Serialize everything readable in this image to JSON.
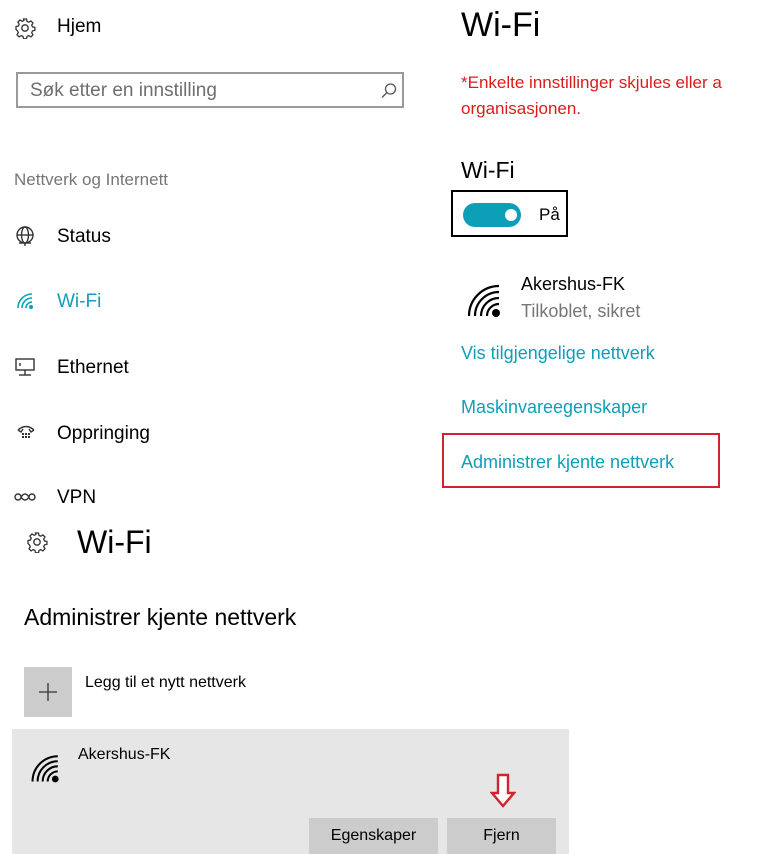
{
  "sidebar": {
    "home_label": "Hjem",
    "search_placeholder": "Søk etter en innstilling",
    "section_label": "Nettverk og Internett",
    "items": [
      {
        "label": "Status",
        "icon": "globe-icon"
      },
      {
        "label": "Wi-Fi",
        "icon": "wifi-icon",
        "active": true
      },
      {
        "label": "Ethernet",
        "icon": "ethernet-icon"
      },
      {
        "label": "Oppringing",
        "icon": "dialup-icon"
      },
      {
        "label": "VPN",
        "icon": "vpn-icon"
      }
    ]
  },
  "main": {
    "title": "Wi-Fi",
    "warning": "*Enkelte innstillinger skjules eller a",
    "warning_line2": "organisasjonen.",
    "wifi_heading": "Wi-Fi",
    "toggle_state": "På",
    "toggle_on": true,
    "network": {
      "name": "Akershus-FK",
      "status": "Tilkoblet, sikret"
    },
    "links": {
      "show_networks": "Vis tilgjengelige nettverk",
      "hardware_props": "Maskinvareegenskaper",
      "manage_known": "Administrer kjente nettverk"
    }
  },
  "manage": {
    "title": "Wi-Fi",
    "heading": "Administrer kjente nettverk",
    "add_label": "Legg til et nytt nettverk",
    "network_name": "Akershus-FK",
    "properties_button": "Egenskaper",
    "remove_button": "Fjern"
  },
  "colors": {
    "accent": "#0e9fb8",
    "warning": "#d91c1c",
    "highlight_frame": "#d2222d"
  }
}
